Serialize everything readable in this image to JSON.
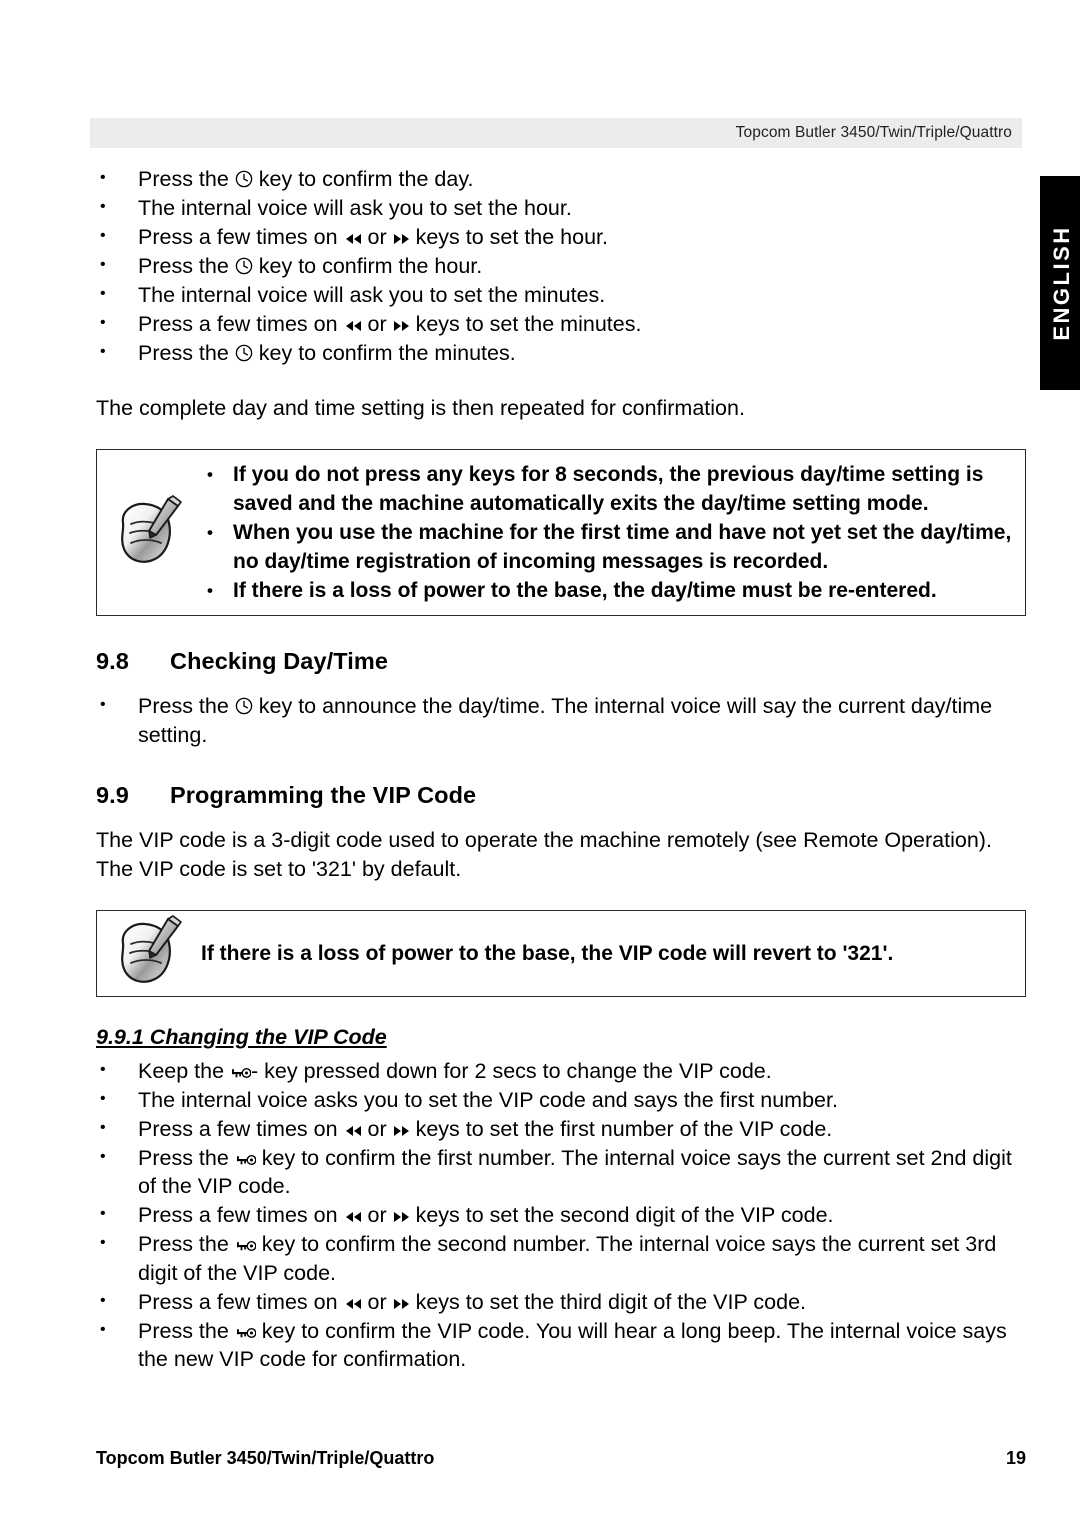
{
  "header": {
    "title": "Topcom Butler 3450/Twin/Triple/Quattro"
  },
  "language_tab": {
    "label": "ENGLISH"
  },
  "icons": {
    "clock": "clock-icon",
    "rewind": "rewind-icon",
    "forward": "fast-forward-icon",
    "key": "key-icon",
    "note_hand": "note-writing-hand-icon"
  },
  "intro_bullets": [
    {
      "pre": "Press the ",
      "icon": "clock",
      "post": " key to confirm the day."
    },
    {
      "pre": "The internal voice will ask you to set the hour.",
      "icon": null,
      "post": ""
    },
    {
      "pre": "Press a few times on ",
      "icon": "rewind-or-forward",
      "post": " keys to set the hour."
    },
    {
      "pre": "Press the ",
      "icon": "clock",
      "post": " key to confirm the hour."
    },
    {
      "pre": "The internal voice will ask you to set the minutes.",
      "icon": null,
      "post": ""
    },
    {
      "pre": "Press a few times on ",
      "icon": "rewind-or-forward",
      "post": " keys to set the minutes."
    },
    {
      "pre": "Press the ",
      "icon": "clock",
      "post": " key to confirm the minutes."
    }
  ],
  "confirmation_paragraph": "The complete day and time setting is then repeated for confirmation.",
  "note_box_1": {
    "bullets": [
      "If you do not press any keys for 8 seconds, the previous day/time setting is saved and the machine automatically exits the day/time setting mode.",
      "When you use the machine for the first time and have not yet set the day/time, no day/time registration of incoming messages is recorded.",
      "If there is a loss of power to the base, the day/time must be re-entered."
    ]
  },
  "section_98": {
    "number": "9.8",
    "title": "Checking Day/Time",
    "bullet": {
      "pre": "Press the ",
      "post": " key to announce the day/time. The internal voice will say the current day/time setting."
    }
  },
  "section_99": {
    "number": "9.9",
    "title": "Programming the VIP Code",
    "paragraph": "The VIP code is a 3-digit code used to operate the machine remotely (see Remote Operation). The VIP code is set to '321' by default."
  },
  "note_box_2": {
    "text": "If there is a loss of power to the base, the VIP code will revert to '321'."
  },
  "section_991": {
    "title": "9.9.1 Changing the VIP Code",
    "bullets": [
      {
        "pre": "Keep the ",
        "icon": "key",
        "post": "- key pressed down for 2 secs to change the VIP code."
      },
      {
        "pre": "The internal voice asks you to set the VIP code and says the first number.",
        "icon": null,
        "post": ""
      },
      {
        "pre": "Press a few times on ",
        "icon": "rewind-or-forward",
        "post": " keys to set the first number of the VIP code."
      },
      {
        "pre": "Press the ",
        "icon": "key",
        "post": " key to confirm the first number. The internal voice says the current set 2nd digit of the VIP code."
      },
      {
        "pre": "Press a few times on ",
        "icon": "rewind-or-forward",
        "post": " keys to set the second digit of the VIP code."
      },
      {
        "pre": "Press the ",
        "icon": "key",
        "post": " key  to confirm the second number. The internal voice says the current set 3rd digit of the VIP code."
      },
      {
        "pre": "Press a few times on ",
        "icon": "rewind-or-forward",
        "post": " keys to set the third digit of the VIP code."
      },
      {
        "pre": "Press the ",
        "icon": "key",
        "post": " key to confirm the VIP code. You will hear a long beep. The internal voice says the new VIP code for confirmation."
      }
    ],
    "or_word": " or "
  },
  "footer": {
    "text": "Topcom Butler 3450/Twin/Triple/Quattro",
    "page": "19"
  }
}
